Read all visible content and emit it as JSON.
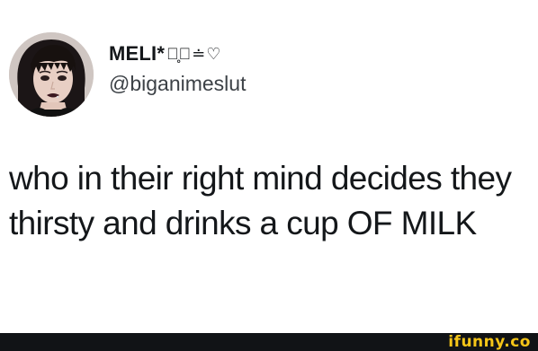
{
  "tweet": {
    "display_name": "MELI*",
    "name_decoration": "⋆̥ᩱ≐♡",
    "handle": "@biganimeslut",
    "text": "who in their right mind decides they thirsty and drinks a cup OF MILK"
  },
  "avatar": {
    "icon": "profile-photo"
  },
  "footer": {
    "watermark": "ifunny.co",
    "watermark_color": "#f5c518",
    "bar_color": "#111316"
  }
}
